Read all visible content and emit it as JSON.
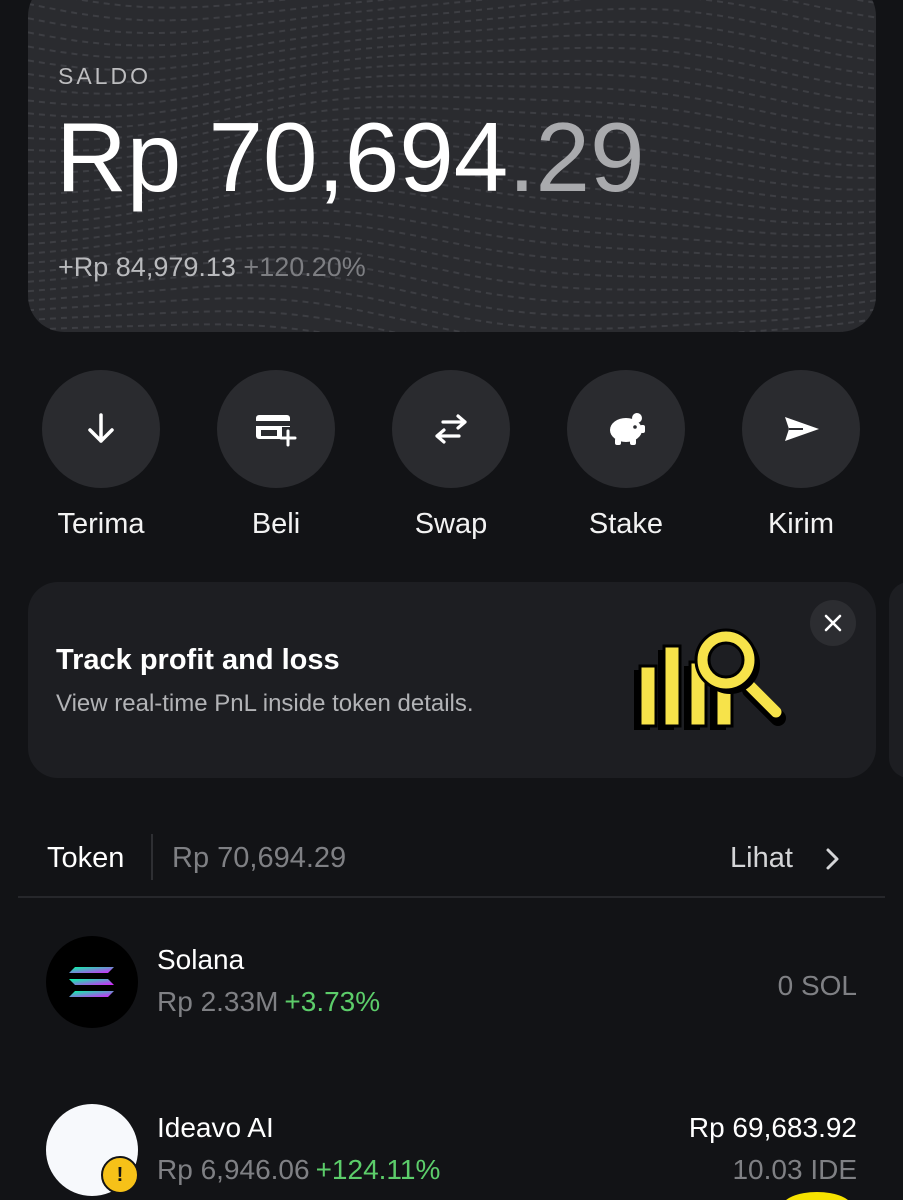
{
  "balance": {
    "label": "SALDO",
    "amount_main": "Rp 70,694",
    "amount_decimals": ".29",
    "change_abs": "+Rp 84,979.13",
    "change_pct": "+120.20%"
  },
  "actions": [
    {
      "label": "Terima",
      "icon": "arrow-down-icon"
    },
    {
      "label": "Beli",
      "icon": "card-plus-icon"
    },
    {
      "label": "Swap",
      "icon": "swap-arrows-icon"
    },
    {
      "label": "Stake",
      "icon": "piggy-bank-icon"
    },
    {
      "label": "Kirim",
      "icon": "send-icon"
    }
  ],
  "promo": {
    "title": "Track profit and loss",
    "subtitle": "View real-time PnL inside token details.",
    "close_icon": "close-icon",
    "illustration_icon": "chart-magnifier-icon",
    "illustration_color": "#f7e34a"
  },
  "tokens_header": {
    "tab": "Token",
    "total": "Rp 70,694.29",
    "see_all": "Lihat"
  },
  "tokens": [
    {
      "name": "Solana",
      "price": "Rp 2.33M",
      "change": "+3.73%",
      "value": "",
      "quantity": "0 SOL",
      "icon": "solana-icon"
    },
    {
      "name": "Ideavo AI",
      "price": "Rp 6,946.06",
      "change": "+124.11%",
      "value": "Rp 69,683.92",
      "quantity": "10.03 IDE",
      "icon": "ideavo-token-icon",
      "warning": "!"
    }
  ],
  "colors": {
    "background": "#121316",
    "card": "#2a2b2f",
    "positive": "#5ccd6a",
    "accent_yellow": "#f6c118"
  }
}
